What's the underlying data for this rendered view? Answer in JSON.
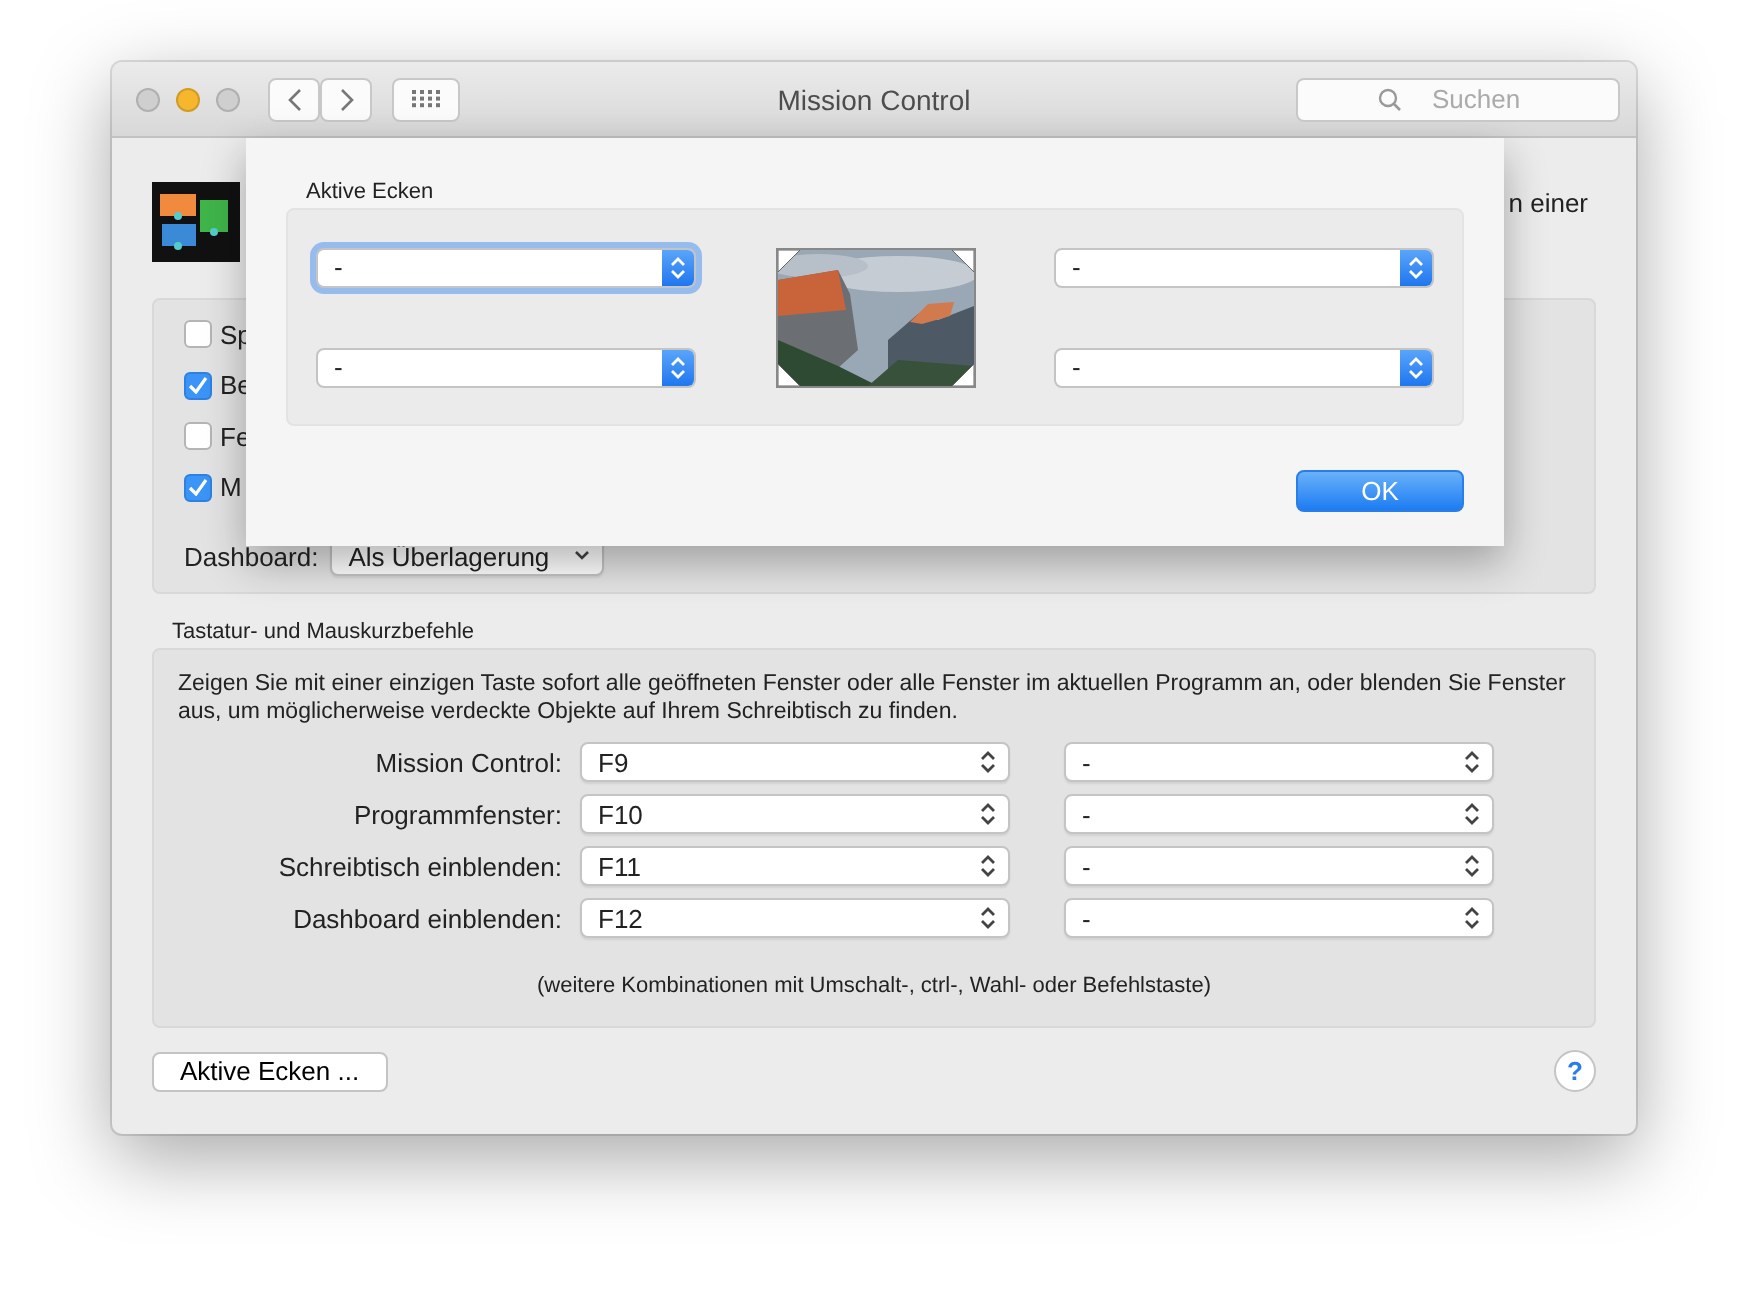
{
  "window": {
    "title": "Mission Control",
    "search": {
      "placeholder": "Suchen"
    }
  },
  "header": {
    "text": "n einer"
  },
  "options": [
    {
      "label": "Sp",
      "checked": false
    },
    {
      "label": "Be",
      "checked": true
    },
    {
      "label": "Fe",
      "checked": false
    },
    {
      "label": "M",
      "checked": true
    }
  ],
  "dashboard": {
    "label": "Dashboard:",
    "value": "Als Überlagerung"
  },
  "shortcuts": {
    "title": "Tastatur- und Mauskurzbefehle",
    "description": "Zeigen Sie mit einer einzigen Taste sofort alle geöffneten Fenster oder alle Fenster im aktuellen Programm an, oder blenden Sie Fenster aus, um möglicherweise verdeckte Objekte auf Ihrem Schreibtisch zu finden.",
    "rows": [
      {
        "label": "Mission Control:",
        "primary": "F9",
        "secondary": "-"
      },
      {
        "label": "Programmfenster:",
        "primary": "F10",
        "secondary": "-"
      },
      {
        "label": "Schreibtisch einblenden:",
        "primary": "F11",
        "secondary": "-"
      },
      {
        "label": "Dashboard einblenden:",
        "primary": "F12",
        "secondary": "-"
      }
    ],
    "note": "(weitere Kombinationen mit Umschalt-, ctrl-, Wahl- oder Befehlstaste)"
  },
  "hot_corners_button": "Aktive Ecken ...",
  "help_button": "?",
  "sheet": {
    "title": "Aktive Ecken",
    "corners": [
      {
        "value": "-",
        "focused": true
      },
      {
        "value": "-",
        "focused": false
      },
      {
        "value": "-",
        "focused": false
      },
      {
        "value": "-",
        "focused": false
      }
    ],
    "ok": "OK"
  }
}
